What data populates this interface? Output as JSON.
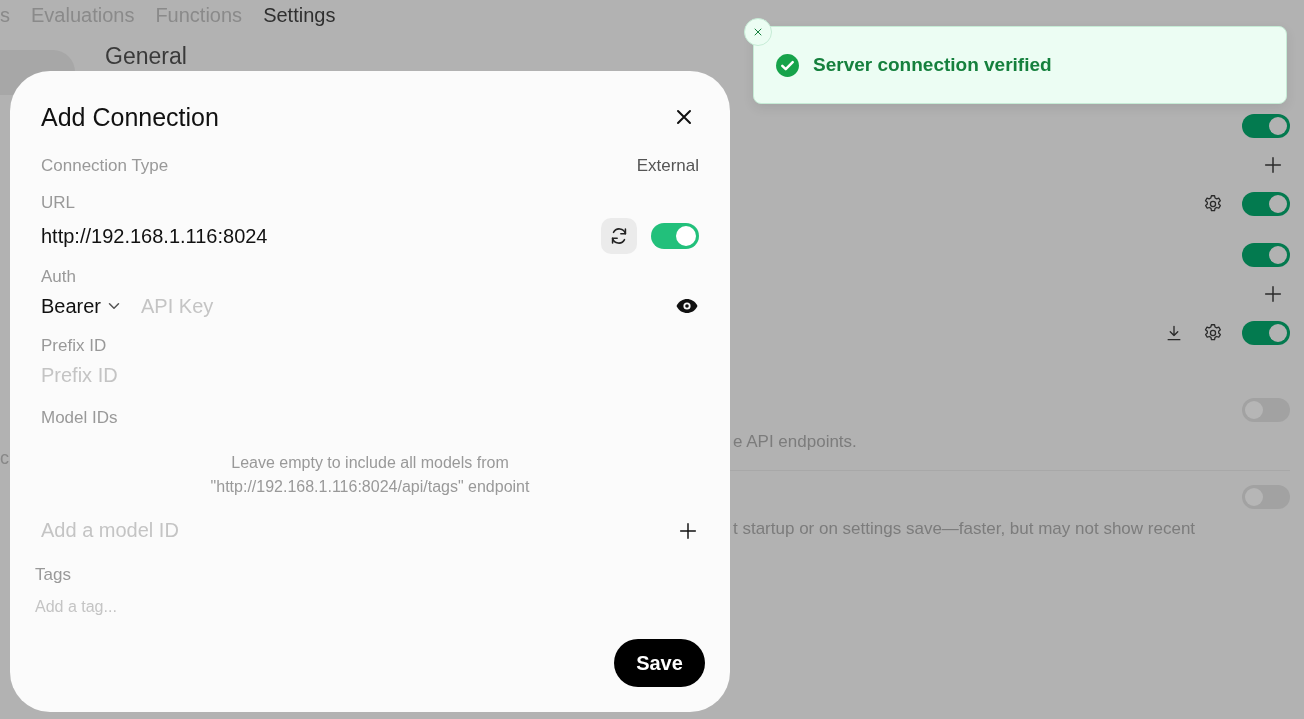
{
  "nav_tabs": [
    {
      "label": "s",
      "selected": false
    },
    {
      "label": "Evaluations",
      "selected": false
    },
    {
      "label": "Functions",
      "selected": false
    },
    {
      "label": "Settings",
      "selected": true
    }
  ],
  "side_fragment": "c",
  "settings_section": {
    "title": "General"
  },
  "settings_groups": [
    [
      {
        "kind": "toggle",
        "on": true
      },
      {
        "kind": "add"
      },
      {
        "kind": "configurable",
        "on": true
      }
    ],
    [
      {
        "kind": "toggle",
        "on": true
      },
      {
        "kind": "add"
      },
      {
        "kind": "downloadable",
        "on": true
      }
    ],
    [
      {
        "kind": "described",
        "on": false,
        "description": "e API endpoints."
      },
      {
        "kind": "described",
        "on": false,
        "description": "t startup or on settings save—faster, but may not show recent"
      }
    ]
  ],
  "dialog": {
    "title": "Add Connection",
    "connection_type": {
      "label": "Connection Type",
      "value": "External"
    },
    "url": {
      "label": "URL",
      "value": "http://192.168.1.116:8024",
      "enabled": true
    },
    "auth": {
      "label": "Auth",
      "method": "Bearer",
      "placeholder": "API Key"
    },
    "prefix_id": {
      "label": "Prefix ID",
      "placeholder": "Prefix ID"
    },
    "model_ids": {
      "label": "Model IDs",
      "hint": "Leave empty to include all models from \"http://192.168.1.116:8024/api/tags\" endpoint",
      "placeholder": "Add a model ID"
    },
    "tags": {
      "label": "Tags",
      "placeholder": "Add a tag..."
    },
    "save_label": "Save"
  },
  "toast": {
    "message": "Server connection verified"
  }
}
